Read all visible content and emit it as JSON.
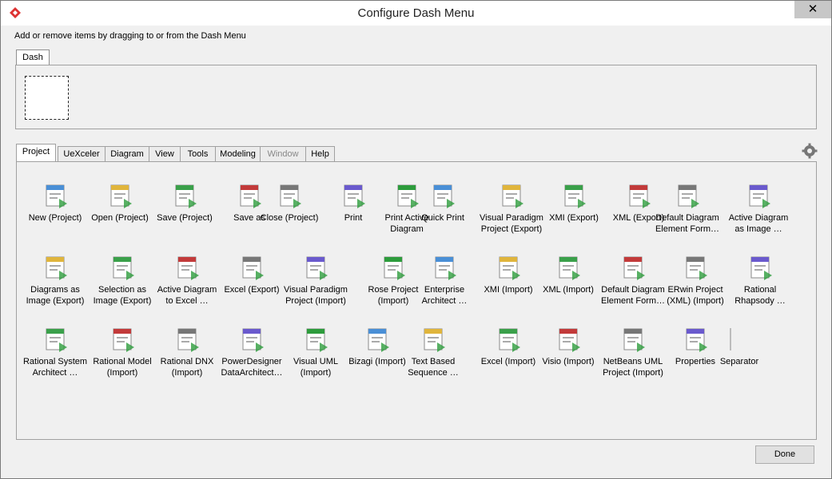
{
  "window": {
    "title": "Configure Dash Menu",
    "close_label": "✕"
  },
  "instruction": "Add or remove items by dragging to or from the Dash Menu",
  "dash": {
    "tab_label": "Dash"
  },
  "tabs": [
    "Project",
    "UeXceler",
    "Diagram",
    "View",
    "Tools",
    "Modeling",
    "Window",
    "Help"
  ],
  "active_tab": "Project",
  "items": [
    [
      "New (Project)",
      "Open (Project)",
      "Save (Project)",
      "Save as",
      "Close (Project)",
      "Print",
      "Print Active\nDiagram",
      "Quick Print",
      "Visual Paradigm\nProject (Export)",
      "XMI (Export)",
      "XML (Export)",
      "Default Diagram\nElement Form…",
      "Active Diagram\nas Image …"
    ],
    [
      "Diagrams as\nImage (Export)",
      "Selection as\nImage (Export)",
      "Active Diagram\nto Excel …",
      "Excel (Export)",
      "Visual Paradigm\nProject (Import)",
      "Rose Project\n(Import)",
      "Enterprise\nArchitect …",
      "XMI (Import)",
      "XML (Import)",
      "Default Diagram\nElement Form…",
      "ERwin Project\n(XML) (Import)",
      "Rational\nRhapsody …"
    ],
    [
      "Rational System\nArchitect …",
      "Rational Model\n(Import)",
      "Rational DNX\n(Import)",
      "PowerDesigner\nDataArchitect…",
      "Visual UML\n(Import)",
      "Bizagi (Import)",
      "Text Based\nSequence …",
      "Excel (Import)",
      "Visio (Import)",
      "NetBeans UML\nProject (Import)",
      "Properties",
      "Separator"
    ]
  ],
  "icons": [
    [
      "new-project-icon",
      "open-project-icon",
      "save-project-icon",
      "save-as-icon",
      "close-project-icon",
      "print-icon",
      "print-diagram-icon",
      "quick-print-icon",
      "vp-export-icon",
      "xmi-export-icon",
      "xml-export-icon",
      "diagram-form-icon",
      "image-export-icon"
    ],
    [
      "diagrams-image-icon",
      "selection-image-icon",
      "excel-diagram-icon",
      "excel-export-icon",
      "vp-import-icon",
      "rose-icon",
      "ea-icon",
      "xmi-import-icon",
      "xml-import-icon",
      "diagram-form-import-icon",
      "erwin-icon",
      "rhapsody-icon"
    ],
    [
      "system-architect-icon",
      "rational-model-icon",
      "rational-dnx-icon",
      "powerdesigner-icon",
      "visual-uml-icon",
      "bizagi-icon",
      "text-sequence-icon",
      "excel-import-icon",
      "visio-icon",
      "netbeans-icon",
      "properties-icon",
      "separator-icon"
    ]
  ],
  "done_label": "Done",
  "colors": {
    "accent": "#3c7bd9",
    "green": "#2d9c3c",
    "red": "#c62828"
  }
}
